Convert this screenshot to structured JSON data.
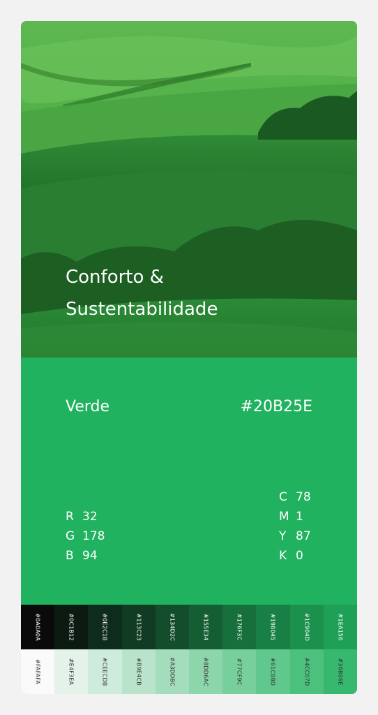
{
  "hero": {
    "title_line1": "Conforto &",
    "title_line2": "Sustentabilidade"
  },
  "color": {
    "name": "Verde",
    "hex": "#20B25E",
    "rgb": [
      {
        "k": "R",
        "v": "32"
      },
      {
        "k": "G",
        "v": "178"
      },
      {
        "k": "B",
        "v": "94"
      }
    ],
    "cmyk": [
      {
        "k": "C",
        "v": "78"
      },
      {
        "k": "M",
        "v": "1"
      },
      {
        "k": "Y",
        "v": "87"
      },
      {
        "k": "K",
        "v": "0"
      }
    ]
  },
  "shades": [
    {
      "label": "#0A0A0A",
      "color": "#0a0a0a",
      "text": "#ffffff"
    },
    {
      "label": "#0C1B12",
      "color": "#0c1b12",
      "text": "#ffffff"
    },
    {
      "label": "#0E2C1B",
      "color": "#0e2c1b",
      "text": "#ffffff"
    },
    {
      "label": "#113C23",
      "color": "#113c23",
      "text": "#ffffff"
    },
    {
      "label": "#134D2C",
      "color": "#134d2c",
      "text": "#ffffff"
    },
    {
      "label": "#155E34",
      "color": "#155e34",
      "text": "#ffffff"
    },
    {
      "label": "#176F3C",
      "color": "#176f3c",
      "text": "#ffffff"
    },
    {
      "label": "#198045",
      "color": "#198045",
      "text": "#ffffff"
    },
    {
      "label": "#1C904D",
      "color": "#1c904d",
      "text": "#ffffff"
    },
    {
      "label": "#1EA156",
      "color": "#1ea156",
      "text": "#ffffff"
    }
  ],
  "tints": [
    {
      "label": "#FAFAFA",
      "color": "#fafafa",
      "text": "#333333"
    },
    {
      "label": "#E4F3EA",
      "color": "#e4f3ea",
      "text": "#333333"
    },
    {
      "label": "#CEECDB",
      "color": "#ceecdb",
      "text": "#333333"
    },
    {
      "label": "#B9E4CB",
      "color": "#b9e4cb",
      "text": "#333333"
    },
    {
      "label": "#A3DDBC",
      "color": "#a3ddbc",
      "text": "#333333"
    },
    {
      "label": "#8DD6AC",
      "color": "#8dd6ac",
      "text": "#333333"
    },
    {
      "label": "#77CF9C",
      "color": "#77cf9c",
      "text": "#333333"
    },
    {
      "label": "#61C88D",
      "color": "#61c88d",
      "text": "#333333"
    },
    {
      "label": "#4CC07D",
      "color": "#4cc07d",
      "text": "#333333"
    },
    {
      "label": "#36B96E",
      "color": "#36b96e",
      "text": "#333333"
    }
  ]
}
